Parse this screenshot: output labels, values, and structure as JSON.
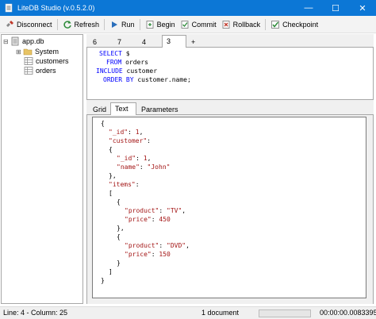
{
  "window": {
    "title": "LiteDB Studio (v.0.5.2.0)",
    "controls": {
      "minimize": "—",
      "maximize": "☐",
      "close": "✕"
    }
  },
  "toolbar": {
    "disconnect": "Disconnect",
    "refresh": "Refresh",
    "run": "Run",
    "begin": "Begin",
    "commit": "Commit",
    "rollback": "Rollback",
    "checkpoint": "Checkpoint"
  },
  "tree": {
    "root": "app.db",
    "items": [
      "System",
      "customers",
      "orders"
    ],
    "expander": "⊞"
  },
  "query_tabs": [
    "6",
    "7",
    "4",
    "3",
    "+"
  ],
  "active_query_tab": "3",
  "editor": {
    "line1_kw": "SELECT",
    "line1_rest": " $",
    "line2_kw": "FROM",
    "line2_rest": " orders",
    "line3_kw": "INCLUDE",
    "line3_rest": " customer",
    "line4_kw": "ORDER BY",
    "line4_rest": " customer.name;"
  },
  "result_tabs": [
    "Grid",
    "Text",
    "Parameters"
  ],
  "active_result_tab": "Text",
  "result_json": {
    "l1": "{",
    "l2_key": "\"_id\"",
    "l2_val": "1",
    "l3_key": "\"customer\"",
    "l4": "{",
    "l5_key": "\"_id\"",
    "l5_val": "1",
    "l6_key": "\"name\"",
    "l6_val": "\"John\"",
    "l7": "},",
    "l8_key": "\"items\"",
    "l9": "[",
    "l10": "{",
    "l11_key": "\"product\"",
    "l11_val": "\"TV\"",
    "l12_key": "\"price\"",
    "l12_val": "450",
    "l13": "},",
    "l14": "{",
    "l15_key": "\"product\"",
    "l15_val": "\"DVD\"",
    "l16_key": "\"price\"",
    "l16_val": "150",
    "l17": "}",
    "l18": "]",
    "l19": "}"
  },
  "status": {
    "position": "Line: 4 - Column: 25",
    "documents": "1 document",
    "elapsed": "00:00:00.0083395"
  },
  "colors": {
    "titlebar": "#0c77d6",
    "keyword": "#0000ff",
    "json_key": "#a31515"
  }
}
